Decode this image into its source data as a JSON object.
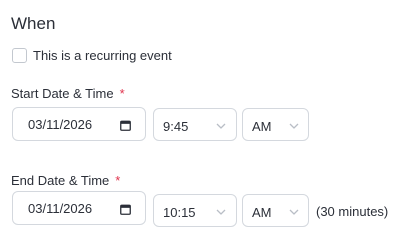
{
  "section": {
    "title": "When"
  },
  "recurring": {
    "label": "This is a recurring event",
    "checked": false
  },
  "start": {
    "label": "Start Date & Time",
    "required_mark": "*",
    "date": "03/11/2026",
    "time": "9:45",
    "ampm": "AM"
  },
  "end": {
    "label": "End Date & Time",
    "required_mark": "*",
    "date": "03/11/2026",
    "time": "10:15",
    "ampm": "AM",
    "duration": "(30 minutes)"
  },
  "icons": {
    "calendar": "calendar-icon",
    "dropdown": "chevron-down-icon"
  },
  "colors": {
    "required": "#e0314b",
    "border": "#d4d8de",
    "text": "#2b2f38",
    "chevron": "#b9bec6"
  }
}
